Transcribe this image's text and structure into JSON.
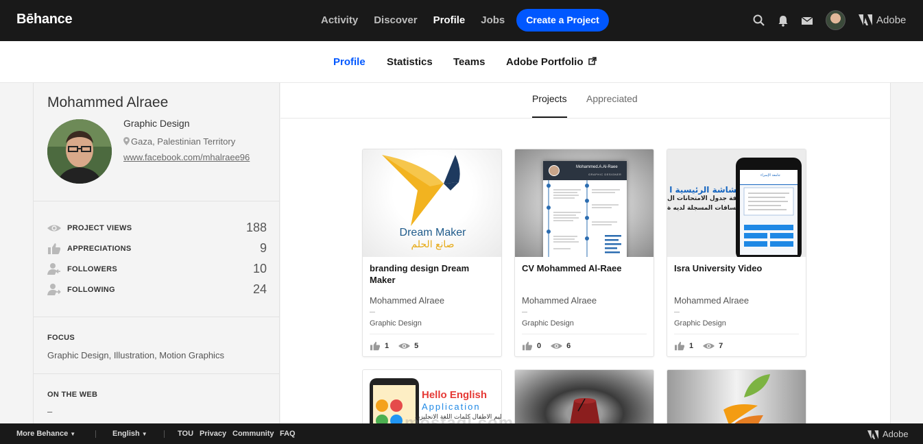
{
  "header": {
    "logo": "Bēhance",
    "nav": [
      "Activity",
      "Discover",
      "Profile",
      "Jobs"
    ],
    "active_nav": "Profile",
    "create_button": "Create a Project",
    "adobe_label": "Adobe",
    "icons": [
      "search-icon",
      "bell-icon",
      "mail-icon",
      "avatar",
      "adobe-logo-icon"
    ]
  },
  "subnav": {
    "items": [
      "Profile",
      "Statistics",
      "Teams",
      "Adobe Portfolio"
    ],
    "active": "Profile"
  },
  "profile": {
    "name": "Mohammed Alraee",
    "field": "Graphic Design",
    "location": "Gaza, Palestinian Territory",
    "website": "www.facebook.com/mhalraee96",
    "stats": [
      {
        "label": "PROJECT VIEWS",
        "value": "188",
        "icon": "eye-icon"
      },
      {
        "label": "APPRECIATIONS",
        "value": "9",
        "icon": "thumbs-up-icon"
      },
      {
        "label": "FOLLOWERS",
        "value": "10",
        "icon": "followers-icon"
      },
      {
        "label": "FOLLOWING",
        "value": "24",
        "icon": "following-icon"
      }
    ],
    "focus_heading": "FOCUS",
    "focus_text": "Graphic Design, Illustration, Motion Graphics",
    "web_heading": "ON THE WEB",
    "web_text": "–"
  },
  "tabs": [
    "Projects",
    "Appreciated"
  ],
  "active_tab": "Projects",
  "projects": [
    {
      "title": "branding design Dream Maker",
      "owner": "Mohammed Alraee",
      "field": "Graphic Design",
      "likes": "1",
      "views": "5",
      "thumb_text": "Dream Maker",
      "thumb_text_ar": "صانع الحلم"
    },
    {
      "title": "CV Mohammed Al-Raee",
      "owner": "Mohammed Alraee",
      "field": "Graphic Design",
      "likes": "0",
      "views": "6",
      "thumb_text": "Mohammed.A.Al-Raee",
      "thumb_sub": "GRAPHIC DESIGNER"
    },
    {
      "title": "Isra University Video",
      "owner": "Mohammed Alraee",
      "field": "Graphic Design",
      "likes": "1",
      "views": "7",
      "thumb_text_ar": "الشاشة الرئيسية ا",
      "thumb_text_ar2": "ومعرفة جدول الامتحانات ال",
      "thumb_text_ar3": "وعلامات المساقات المسجلة لديه ة",
      "thumb_app": "جامعة الإسراء"
    }
  ],
  "more_projects": [
    {
      "thumb_text": "Hello English",
      "thumb_sub": "Application",
      "thumb_ar": "تعليم الاطفال كلمات اللغة الانجليزية"
    },
    {},
    {}
  ],
  "watermark": "mostaql.com",
  "footer": {
    "items": [
      "More Behance",
      "English",
      "TOU",
      "Privacy",
      "Community",
      "FAQ"
    ],
    "adobe_label": "Adobe"
  },
  "colors": {
    "accent": "#0057ff",
    "topbar": "#191919",
    "dream_gold": "#f2b320",
    "dream_navy": "#1e3a5f"
  }
}
